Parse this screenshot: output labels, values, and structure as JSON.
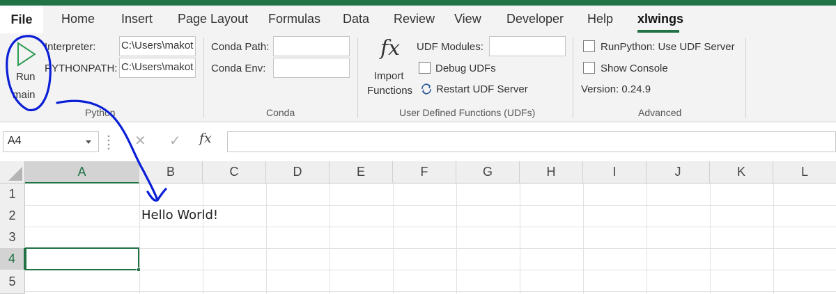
{
  "tabs": [
    "File",
    "Home",
    "Insert",
    "Page Layout",
    "Formulas",
    "Data",
    "Review",
    "View",
    "Developer",
    "Help",
    "xlwings"
  ],
  "ribbon": {
    "python": {
      "run_label_1": "Run",
      "run_label_2": "main",
      "interpreter_label": "Interpreter:",
      "interpreter_value": "C:\\Users\\makot",
      "pythonpath_label": "PYTHONPATH:",
      "pythonpath_value": "C:\\Users\\makot",
      "group_label": "Python"
    },
    "conda": {
      "path_label": "Conda Path:",
      "env_label": "Conda Env:",
      "path_value": "",
      "env_value": "",
      "group_label": "Conda"
    },
    "udfs": {
      "import_label_1": "Import",
      "import_label_2": "Functions",
      "modules_label": "UDF Modules:",
      "modules_value": "",
      "debug_label": "Debug UDFs",
      "restart_label": "Restart UDF Server",
      "group_label": "User Defined Functions (UDFs)"
    },
    "advanced": {
      "runpython_label": "RunPython: Use UDF Server",
      "show_console_label": "Show Console",
      "version_label": "Version: 0.24.9",
      "group_label": "Advanced"
    }
  },
  "formula_bar": {
    "name_box": "A4",
    "formula": ""
  },
  "sheet": {
    "columns": [
      "A",
      "B",
      "C",
      "D",
      "E",
      "F",
      "G",
      "H",
      "I",
      "J",
      "K",
      "L"
    ],
    "rows": [
      "1",
      "2",
      "3",
      "4",
      "5"
    ],
    "cells": {
      "B2": "Hello World!"
    },
    "active_cell": "A4"
  },
  "colors": {
    "accent": "#217346",
    "annotation": "#0a1fd6"
  }
}
